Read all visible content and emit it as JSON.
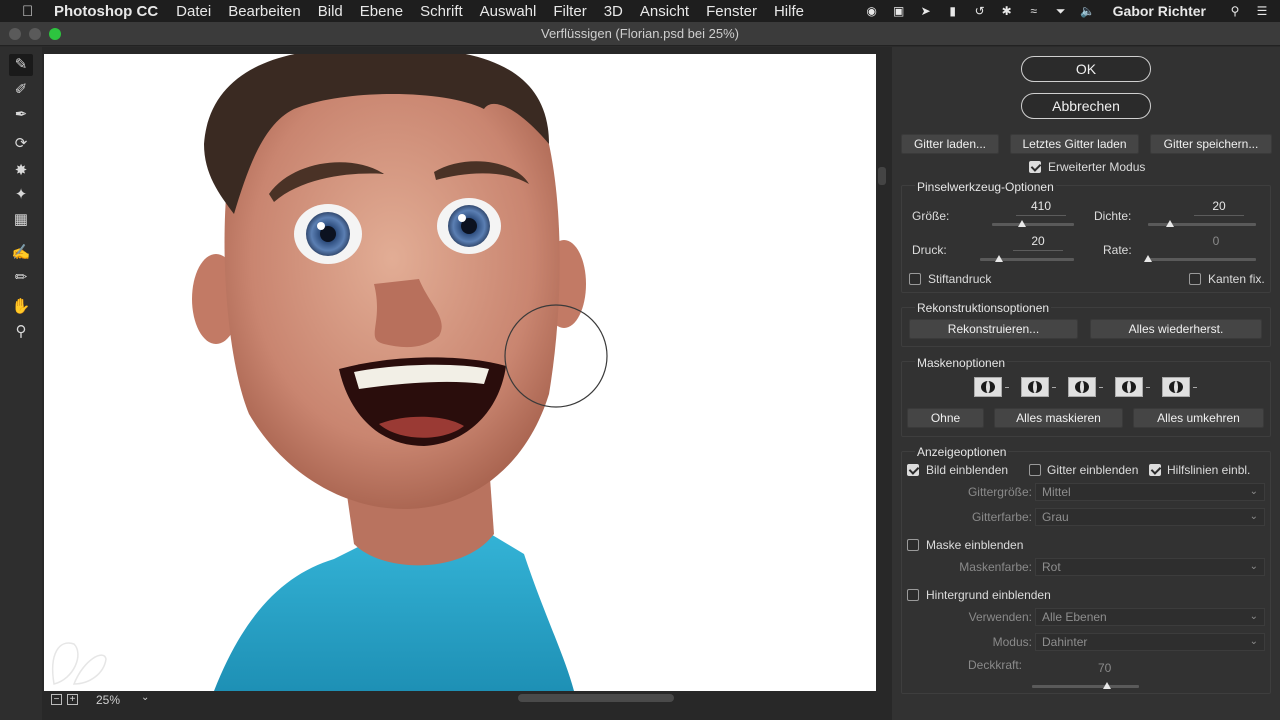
{
  "menubar": {
    "app_name": "Photoshop CC",
    "items": [
      "Datei",
      "Bearbeiten",
      "Bild",
      "Ebene",
      "Schrift",
      "Auswahl",
      "Filter",
      "3D",
      "Ansicht",
      "Fenster",
      "Hilfe"
    ],
    "user": "Gabor Richter"
  },
  "window": {
    "title": "Verflüssigen (Florian.psd bei 25%)"
  },
  "statusbar": {
    "zoom": "25%"
  },
  "panel": {
    "ok": "OK",
    "cancel": "Abbrechen",
    "mesh": {
      "load": "Gitter laden...",
      "load_last": "Letztes Gitter laden",
      "save": "Gitter speichern..."
    },
    "advanced_mode": {
      "label": "Erweiterter Modus",
      "checked": true
    },
    "brush": {
      "title": "Pinselwerkzeug-Optionen",
      "size_label": "Größe:",
      "size": "410",
      "density_label": "Dichte:",
      "density": "20",
      "pressure_label": "Druck:",
      "pressure": "20",
      "rate_label": "Rate:",
      "rate": "0",
      "stylus_label": "Stiftandruck",
      "pin_edges_label": "Kanten fix."
    },
    "reconstruct": {
      "title": "Rekonstruktionsoptionen",
      "reconstruct": "Rekonstruieren...",
      "restore_all": "Alles wiederherst."
    },
    "mask": {
      "title": "Maskenoptionen",
      "none": "Ohne",
      "mask_all": "Alles maskieren",
      "invert_all": "Alles umkehren"
    },
    "view": {
      "title": "Anzeigeoptionen",
      "show_image": "Bild einblenden",
      "show_mesh": "Gitter einblenden",
      "show_guides": "Hilfslinien einbl.",
      "mesh_size_label": "Gittergröße:",
      "mesh_size": "Mittel",
      "mesh_color_label": "Gitterfarbe:",
      "mesh_color": "Grau",
      "show_mask": "Maske einblenden",
      "mask_color_label": "Maskenfarbe:",
      "mask_color": "Rot",
      "show_backdrop": "Hintergrund einblenden",
      "use_label": "Verwenden:",
      "use": "Alle Ebenen",
      "mode_label": "Modus:",
      "mode": "Dahinter",
      "opacity_label": "Deckkraft:",
      "opacity": "70"
    }
  },
  "sliders": {
    "size": 0.37,
    "density": 0.2,
    "pressure": 0.2,
    "rate": 0.0,
    "opacity": 0.7
  },
  "colors": {
    "menubar": "#1e1e1e",
    "panel": "#323232",
    "canvas": "#ffffff",
    "shirt": "#2aa6c9",
    "skin": "#d49a84"
  }
}
